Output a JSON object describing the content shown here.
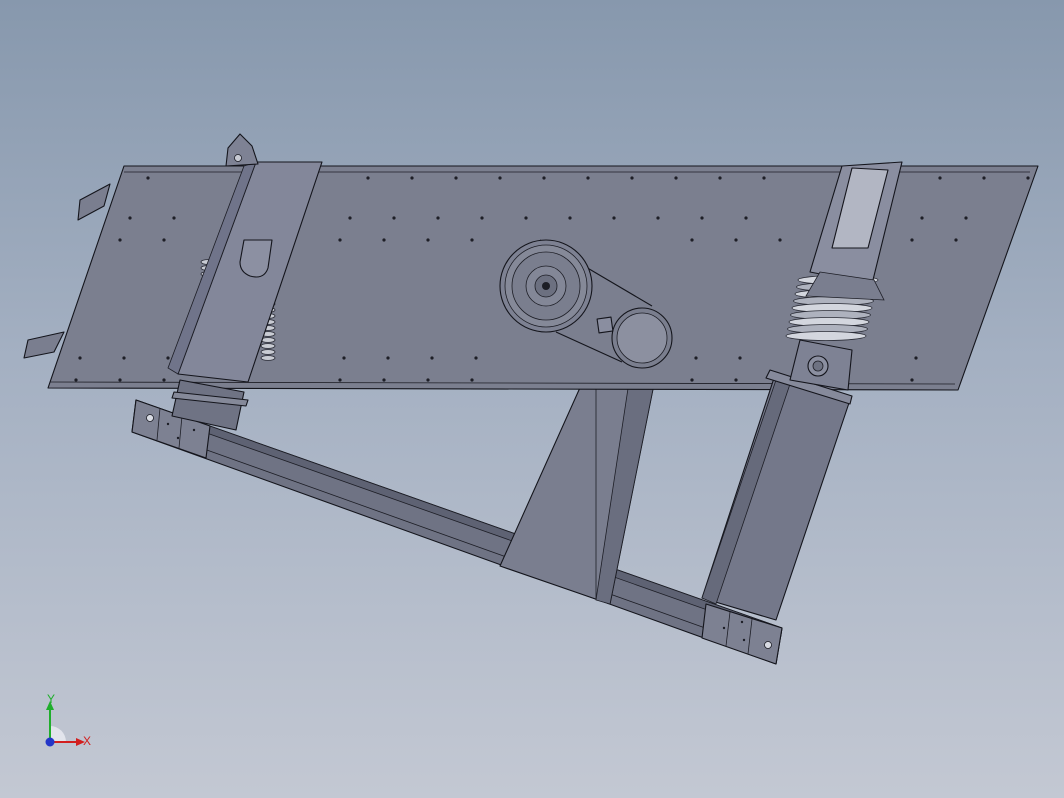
{
  "viewport": {
    "background_top": "#8798ad",
    "background_bottom": "#c3c8d3"
  },
  "model": {
    "subject": "vibrating-screen-assembly",
    "body_color": "#7b7f8f",
    "body_color_light": "#888c9b",
    "edge_color": "#14151c"
  },
  "triad": {
    "x_label": "X",
    "y_label": "Y",
    "x_color": "#d21f1f",
    "y_color": "#1fae2c",
    "z_color": "#2436c8"
  }
}
